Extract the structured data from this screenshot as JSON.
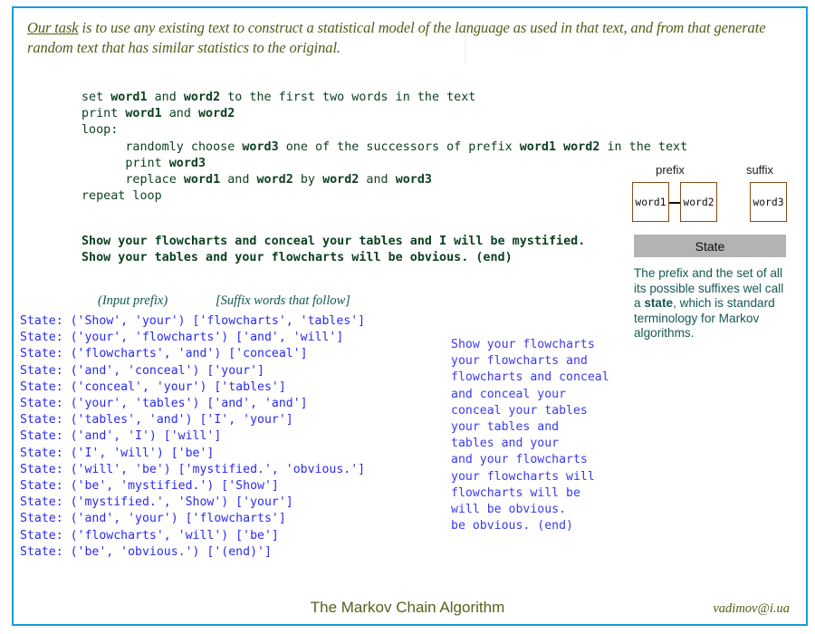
{
  "theme": {
    "frame_border": "#1b9cd8",
    "code_green": "#0d4022",
    "state_blue": "#2a2aee",
    "output_blue": "#3a3aee",
    "note_teal": "#15594f",
    "olive": "#4d5e16",
    "box_border": "#8a4b18",
    "state_bar_bg": "#b3b3b3"
  },
  "intro": {
    "emphasis": "Our task",
    "rest": " is to use any existing text to construct a statistical model of the language as used in that text, and from that generate random text that has similar statistics to the original."
  },
  "pseudocode": {
    "lines": [
      [
        {
          "t": "set ",
          "b": false
        },
        {
          "t": "word1",
          "b": true
        },
        {
          "t": " and ",
          "b": false
        },
        {
          "t": "word2",
          "b": true
        },
        {
          "t": " to the first two words in the text",
          "b": false
        }
      ],
      [
        {
          "t": "print ",
          "b": false
        },
        {
          "t": "word1",
          "b": true
        },
        {
          "t": " and ",
          "b": false
        },
        {
          "t": "word2",
          "b": true
        }
      ],
      [
        {
          "t": "loop:",
          "b": false
        }
      ],
      [
        {
          "t": "      randomly choose ",
          "b": false
        },
        {
          "t": "word3",
          "b": true
        },
        {
          "t": " one of the successors of prefix ",
          "b": false
        },
        {
          "t": "word1 word2",
          "b": true
        },
        {
          "t": " in the text",
          "b": false
        }
      ],
      [
        {
          "t": "      print ",
          "b": false
        },
        {
          "t": "word3",
          "b": true
        }
      ],
      [
        {
          "t": "      replace ",
          "b": false
        },
        {
          "t": "word1",
          "b": true
        },
        {
          "t": " and ",
          "b": false
        },
        {
          "t": "word2",
          "b": true
        },
        {
          "t": " by ",
          "b": false
        },
        {
          "t": "word2",
          "b": true
        },
        {
          "t": " and ",
          "b": false
        },
        {
          "t": "word3",
          "b": true
        }
      ],
      [
        {
          "t": "repeat loop",
          "b": false
        }
      ]
    ]
  },
  "sample_text": {
    "lines": [
      "Show your flowcharts and conceal your tables and I will be mystified.",
      "Show your tables and your flowcharts will be obvious. (end)"
    ]
  },
  "columns": {
    "prefix_caption": "(Input prefix)",
    "suffix_caption": "[Suffix words that follow]"
  },
  "states": {
    "lines": [
      "State: ('Show', 'your') ['flowcharts', 'tables']",
      "State: ('your', 'flowcharts') ['and', 'will']",
      "State: ('flowcharts', 'and') ['conceal']",
      "State: ('and', 'conceal') ['your']",
      "State: ('conceal', 'your') ['tables']",
      "State: ('your', 'tables') ['and', 'and']",
      "State: ('tables', 'and') ['I', 'your']",
      "State: ('and', 'I') ['will']",
      "State: ('I', 'will') ['be']",
      "State: ('will', 'be') ['mystified.', 'obvious.']",
      "State: ('be', 'mystified.') ['Show']",
      "State: ('mystified.', 'Show') ['your']",
      "State: ('and', 'your') ['flowcharts']",
      "State: ('flowcharts', 'will') ['be']",
      "State: ('be', 'obvious.') ['(end)']"
    ]
  },
  "generated": {
    "lines": [
      "Show your flowcharts",
      "your flowcharts and",
      "flowcharts and conceal",
      "and conceal your",
      "conceal your tables",
      "your tables and",
      "tables and your",
      "and your flowcharts",
      "your flowcharts will",
      "flowcharts will be",
      "will be obvious.",
      "be obvious. (end)"
    ]
  },
  "diagram": {
    "prefix_label": "prefix",
    "suffix_label": "suffix",
    "word1": "word1",
    "word2": "word2",
    "word3": "word3",
    "state_bar_label": "State"
  },
  "note": {
    "part1": "The prefix and the set of all its possible suffixes wel call a ",
    "bold": "state",
    "part2": ", which is standard terminology for Markov algorithms."
  },
  "footer": {
    "title": "The Markov Chain Algorithm",
    "email": "vadimov@i.ua"
  }
}
